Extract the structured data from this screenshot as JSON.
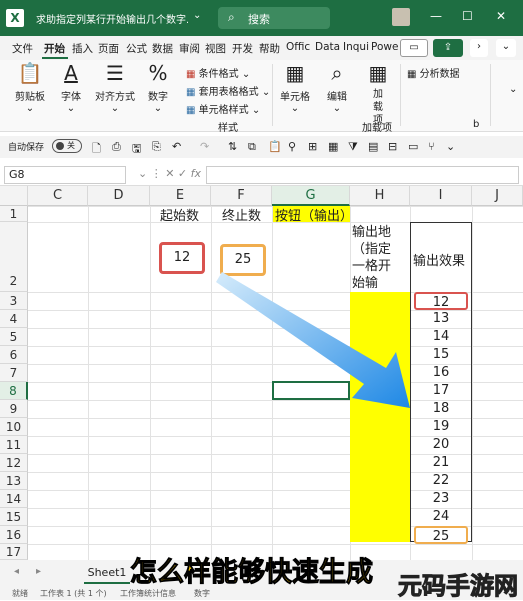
{
  "titlebar": {
    "app_icon": "X",
    "title": "求助指定列某行开始输出几个数字.x...",
    "search_placeholder": "搜索",
    "search_icon": "search-icon",
    "minimize": "—",
    "maximize": "☐",
    "close": "✕"
  },
  "ribbon_tabs": [
    "文件",
    "开始",
    "插入",
    "页面",
    "公式",
    "数据",
    "审阅",
    "视图",
    "开发",
    "帮助",
    "Offic",
    "Data",
    "Inqui",
    "Powe"
  ],
  "ribbon_tab_active": "开始",
  "ribbon": {
    "clipboard": "剪贴板",
    "font": "字体",
    "align": "对齐方式",
    "number": "数字",
    "cond_format": "条件格式",
    "table_format": "套用表格格式",
    "cell_style": "单元格样式",
    "styles": "样式",
    "cells": "单元格",
    "edit": "编辑",
    "addins": "加载项",
    "addins_group": "加载项",
    "analyze": "分析数据"
  },
  "qat": {
    "autosave": "自动保存",
    "toggle": "关"
  },
  "formula_bar": {
    "name_box": "G8",
    "fx": "fx",
    "value": ""
  },
  "columns": [
    "C",
    "D",
    "E",
    "F",
    "G",
    "H",
    "I",
    "J"
  ],
  "selected_column": "G",
  "rows": [
    "1",
    "2",
    "3",
    "4",
    "5",
    "6",
    "7",
    "8",
    "9",
    "10",
    "11",
    "12",
    "13",
    "14",
    "15",
    "16",
    "17"
  ],
  "selected_row": "8",
  "cells": {
    "e1": "起始数",
    "f1": "终止数",
    "g1": "按钮（输出）",
    "h1_2": "输出地（指定一格开始输",
    "i1_2": "输出效果",
    "start_value": "12",
    "end_value": "25",
    "output_values": [
      "12",
      "13",
      "14",
      "15",
      "16",
      "17",
      "18",
      "19",
      "20",
      "21",
      "22",
      "23",
      "24",
      "25"
    ]
  },
  "status": {
    "sheet": "Sheet1",
    "items": [
      "就绪",
      "工作表 1 (共 1 个)",
      "工作簿统计信息",
      "数字"
    ]
  },
  "overlay": {
    "subtitle": "怎么样能够快速生成",
    "watermark": "元码手游网"
  },
  "colors": {
    "accent": "#1e6e42",
    "highlight": "#ffff00",
    "red_box": "#d9534f",
    "orange_box": "#f0ad4e",
    "arrow": "#2f97e0"
  }
}
